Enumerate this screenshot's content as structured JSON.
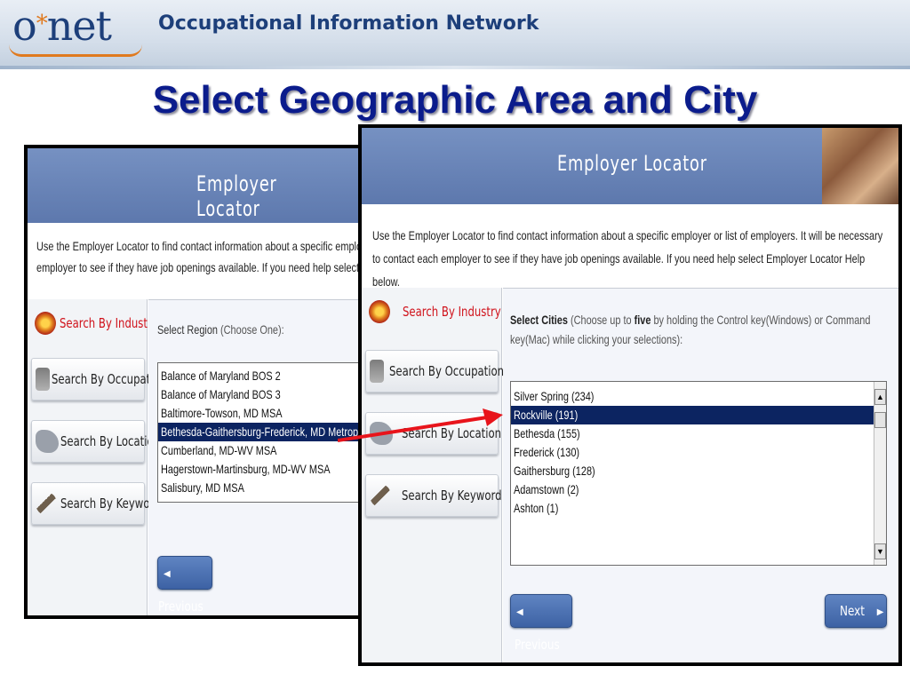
{
  "banner": {
    "logo_left": "o",
    "logo_star": "*",
    "logo_right": "net",
    "title": "Occupational Information Network"
  },
  "slide_title": "Select Geographic Area and City",
  "left_shot": {
    "header_title": "Employer Locator",
    "intro_line1": "Use the Employer Locator to find contact information about a specific employer or list of employers",
    "intro_line2": "employer to see if they have job openings available. If you need help select Employer Locator Help",
    "nav": [
      {
        "label": "Search By Industry"
      },
      {
        "label": "Search By Occupation"
      },
      {
        "label": "Search By Location"
      },
      {
        "label": "Search By Keyword"
      }
    ],
    "select_label": "Select Region",
    "select_hint": "(Choose One):",
    "regions": [
      "Balance of Maryland BOS 2",
      "Balance of Maryland BOS 3",
      "Baltimore-Towson, MD MSA",
      "Bethesda-Gaithersburg-Frederick, MD Metropolitan Division",
      "Cumberland, MD-WV MSA",
      "Hagerstown-Martinsburg, MD-WV MSA",
      "Salisbury, MD MSA"
    ],
    "selected_region_index": 3,
    "previous_label": "Previous"
  },
  "right_shot": {
    "header_title": "Employer Locator",
    "intro": "Use the Employer Locator to find contact information about a specific employer or list of employers. It will be necessary to contact each employer to see if they have job openings available. If you need help select Employer Locator Help below.",
    "nav": [
      {
        "label": "Search By Industry"
      },
      {
        "label": "Search By Occupation"
      },
      {
        "label": "Search By Location"
      },
      {
        "label": "Search By Keyword"
      }
    ],
    "select_bold": "Select Cities",
    "select_hint_1": "(Choose up to",
    "select_hint_five": "five",
    "select_hint_2": "by holding the Control key(Windows) or Command key(Mac) while clicking your selections):",
    "cities": [
      "Silver Spring (234)",
      "Rockville (191)",
      "Bethesda (155)",
      "Frederick (130)",
      "Gaithersburg (128)",
      "Adamstown (2)",
      "Ashton (1)"
    ],
    "selected_city_index": 1,
    "previous_label": "Previous",
    "next_label": "Next"
  },
  "colors": {
    "slide_title": "#0b1c8c",
    "selection": "#0c2461",
    "arrow": "#e8141b",
    "active_nav": "#d0121b"
  }
}
